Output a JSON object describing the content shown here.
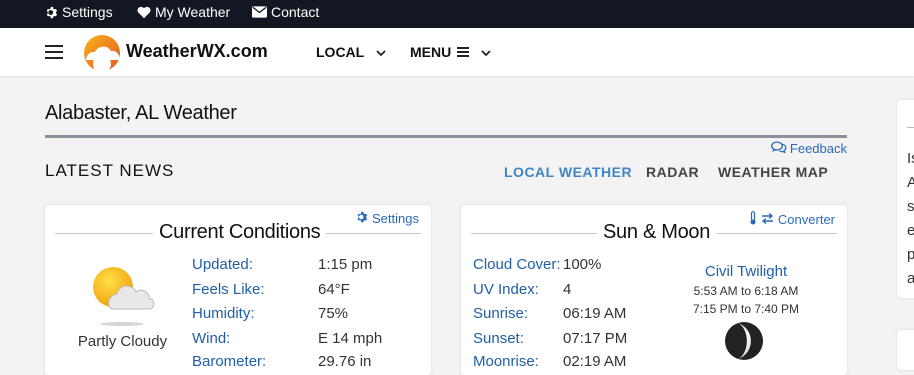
{
  "topbar": {
    "settings_label": "Settings",
    "my_weather_label": "My Weather",
    "contact_label": "Contact"
  },
  "nav": {
    "brand": "WeatherWX.com",
    "local_label": "LOCAL",
    "menu_label": "MENU"
  },
  "page": {
    "title": "Alabaster, AL Weather",
    "feedback_label": "Feedback",
    "latest_news_label": "LATEST NEWS",
    "tabs": [
      {
        "label": "LOCAL WEATHER"
      },
      {
        "label": "RADAR"
      },
      {
        "label": "WEATHER MAP"
      }
    ]
  },
  "current": {
    "title": "Current Conditions",
    "settings_label": "Settings",
    "condition": "Partly Cloudy",
    "rows": [
      {
        "label": "Updated:",
        "value": "1:15 pm"
      },
      {
        "label": "Feels Like:",
        "value": "64°F"
      },
      {
        "label": "Humidity:",
        "value": "75%"
      },
      {
        "label": "Wind:",
        "value": "E 14 mph"
      },
      {
        "label": "Barometer:",
        "value": "29.76 in"
      }
    ]
  },
  "sunmoon": {
    "title": "Sun & Moon",
    "converter_label": "Converter",
    "rows": [
      {
        "label": "Cloud Cover:",
        "value": "100%"
      },
      {
        "label": "UV Index:",
        "value": "4"
      },
      {
        "label": "Sunrise:",
        "value": "06:19 AM"
      },
      {
        "label": "Sunset:",
        "value": "07:17 PM"
      },
      {
        "label": "Moonrise:",
        "value": "02:19 AM"
      }
    ],
    "twilight_title": "Civil Twilight",
    "twilight_morning": "5:53 AM to 6:18 AM",
    "twilight_evening": "7:15 PM to 7:40 PM"
  },
  "sidebar": {
    "letters": [
      "Is",
      "A",
      "s",
      "e",
      "p",
      "a"
    ]
  },
  "colors": {
    "topbar_bg": "#131722",
    "link_blue": "#2a6ab7",
    "active_tab": "#3f86c2"
  }
}
